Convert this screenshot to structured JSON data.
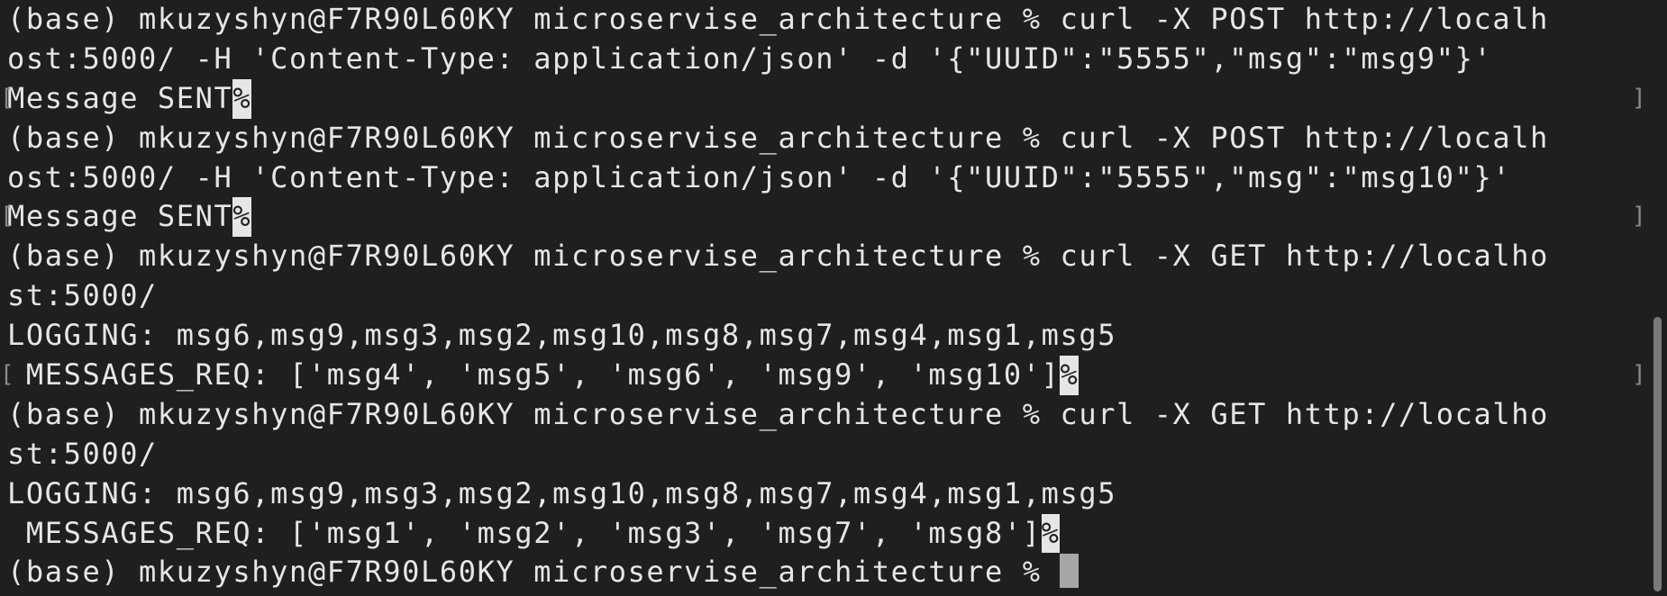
{
  "terminal": {
    "lines": [
      {
        "text": "(base) mkuzyshyn@F7R90L60KY microservise_architecture % curl -X POST http://localh"
      },
      {
        "text": "ost:5000/ -H 'Content-Type: application/json' -d '{\"UUID\":\"5555\",\"msg\":\"msg9\"}'"
      },
      {
        "text": "Message SENT",
        "suffix": "%",
        "bracket_left": "[",
        "bracket_right": "]"
      },
      {
        "text": "(base) mkuzyshyn@F7R90L60KY microservise_architecture % curl -X POST http://localh"
      },
      {
        "text": "ost:5000/ -H 'Content-Type: application/json' -d '{\"UUID\":\"5555\",\"msg\":\"msg10\"}'"
      },
      {
        "text": "Message SENT",
        "suffix": "%",
        "bracket_left": "[",
        "bracket_right": "]"
      },
      {
        "text": "(base) mkuzyshyn@F7R90L60KY microservise_architecture % curl -X GET http://localho"
      },
      {
        "text": "st:5000/"
      },
      {
        "text": "LOGGING: msg6,msg9,msg3,msg2,msg10,msg8,msg7,msg4,msg1,msg5"
      },
      {
        "text": " MESSAGES_REQ: ['msg4', 'msg5', 'msg6', 'msg9', 'msg10']",
        "suffix": "%",
        "bracket_left": "[",
        "bracket_right": "]"
      },
      {
        "text": "(base) mkuzyshyn@F7R90L60KY microservise_architecture % curl -X GET http://localho"
      },
      {
        "text": "st:5000/"
      },
      {
        "text": "LOGGING: msg6,msg9,msg3,msg2,msg10,msg8,msg7,msg4,msg1,msg5"
      },
      {
        "text": " MESSAGES_REQ: ['msg1', 'msg2', 'msg3', 'msg7', 'msg8']",
        "suffix": "%"
      },
      {
        "text": "(base) mkuzyshyn@F7R90L60KY microservise_architecture % ",
        "cursor": true
      }
    ]
  },
  "colors": {
    "background": "#1f1f1f",
    "foreground": "#e6e6e6",
    "cursor": "#a6a6a6"
  }
}
